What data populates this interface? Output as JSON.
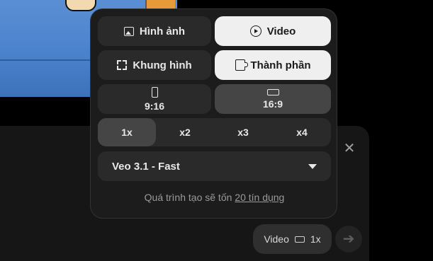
{
  "tabs": {
    "image_label": "Hình ảnh",
    "video_label": "Video",
    "selected": "Video"
  },
  "modes": {
    "frame_label": "Khung hình",
    "ingredients_label": "Thành phần",
    "selected": "Thành phần"
  },
  "aspect": {
    "portrait_label": "9:16",
    "landscape_label": "16:9",
    "selected": "16:9"
  },
  "multiplier": {
    "options": [
      "1x",
      "x2",
      "x3",
      "x4"
    ],
    "selected": "1x"
  },
  "model": {
    "label": "Veo 3.1 - Fast"
  },
  "cost": {
    "prefix": "Quá trình tạo sẽ tốn",
    "link": "20 tín dụng"
  },
  "composer": {
    "chip_mode": "Video",
    "chip_count": "1x",
    "close_icon": "close-icon",
    "send_icon": "arrow-right-icon"
  },
  "colors": {
    "popup_bg": "#1c1c1c",
    "selected_light": "#efefef",
    "selected_grey": "#454545",
    "unselected": "#2a2a2a"
  }
}
